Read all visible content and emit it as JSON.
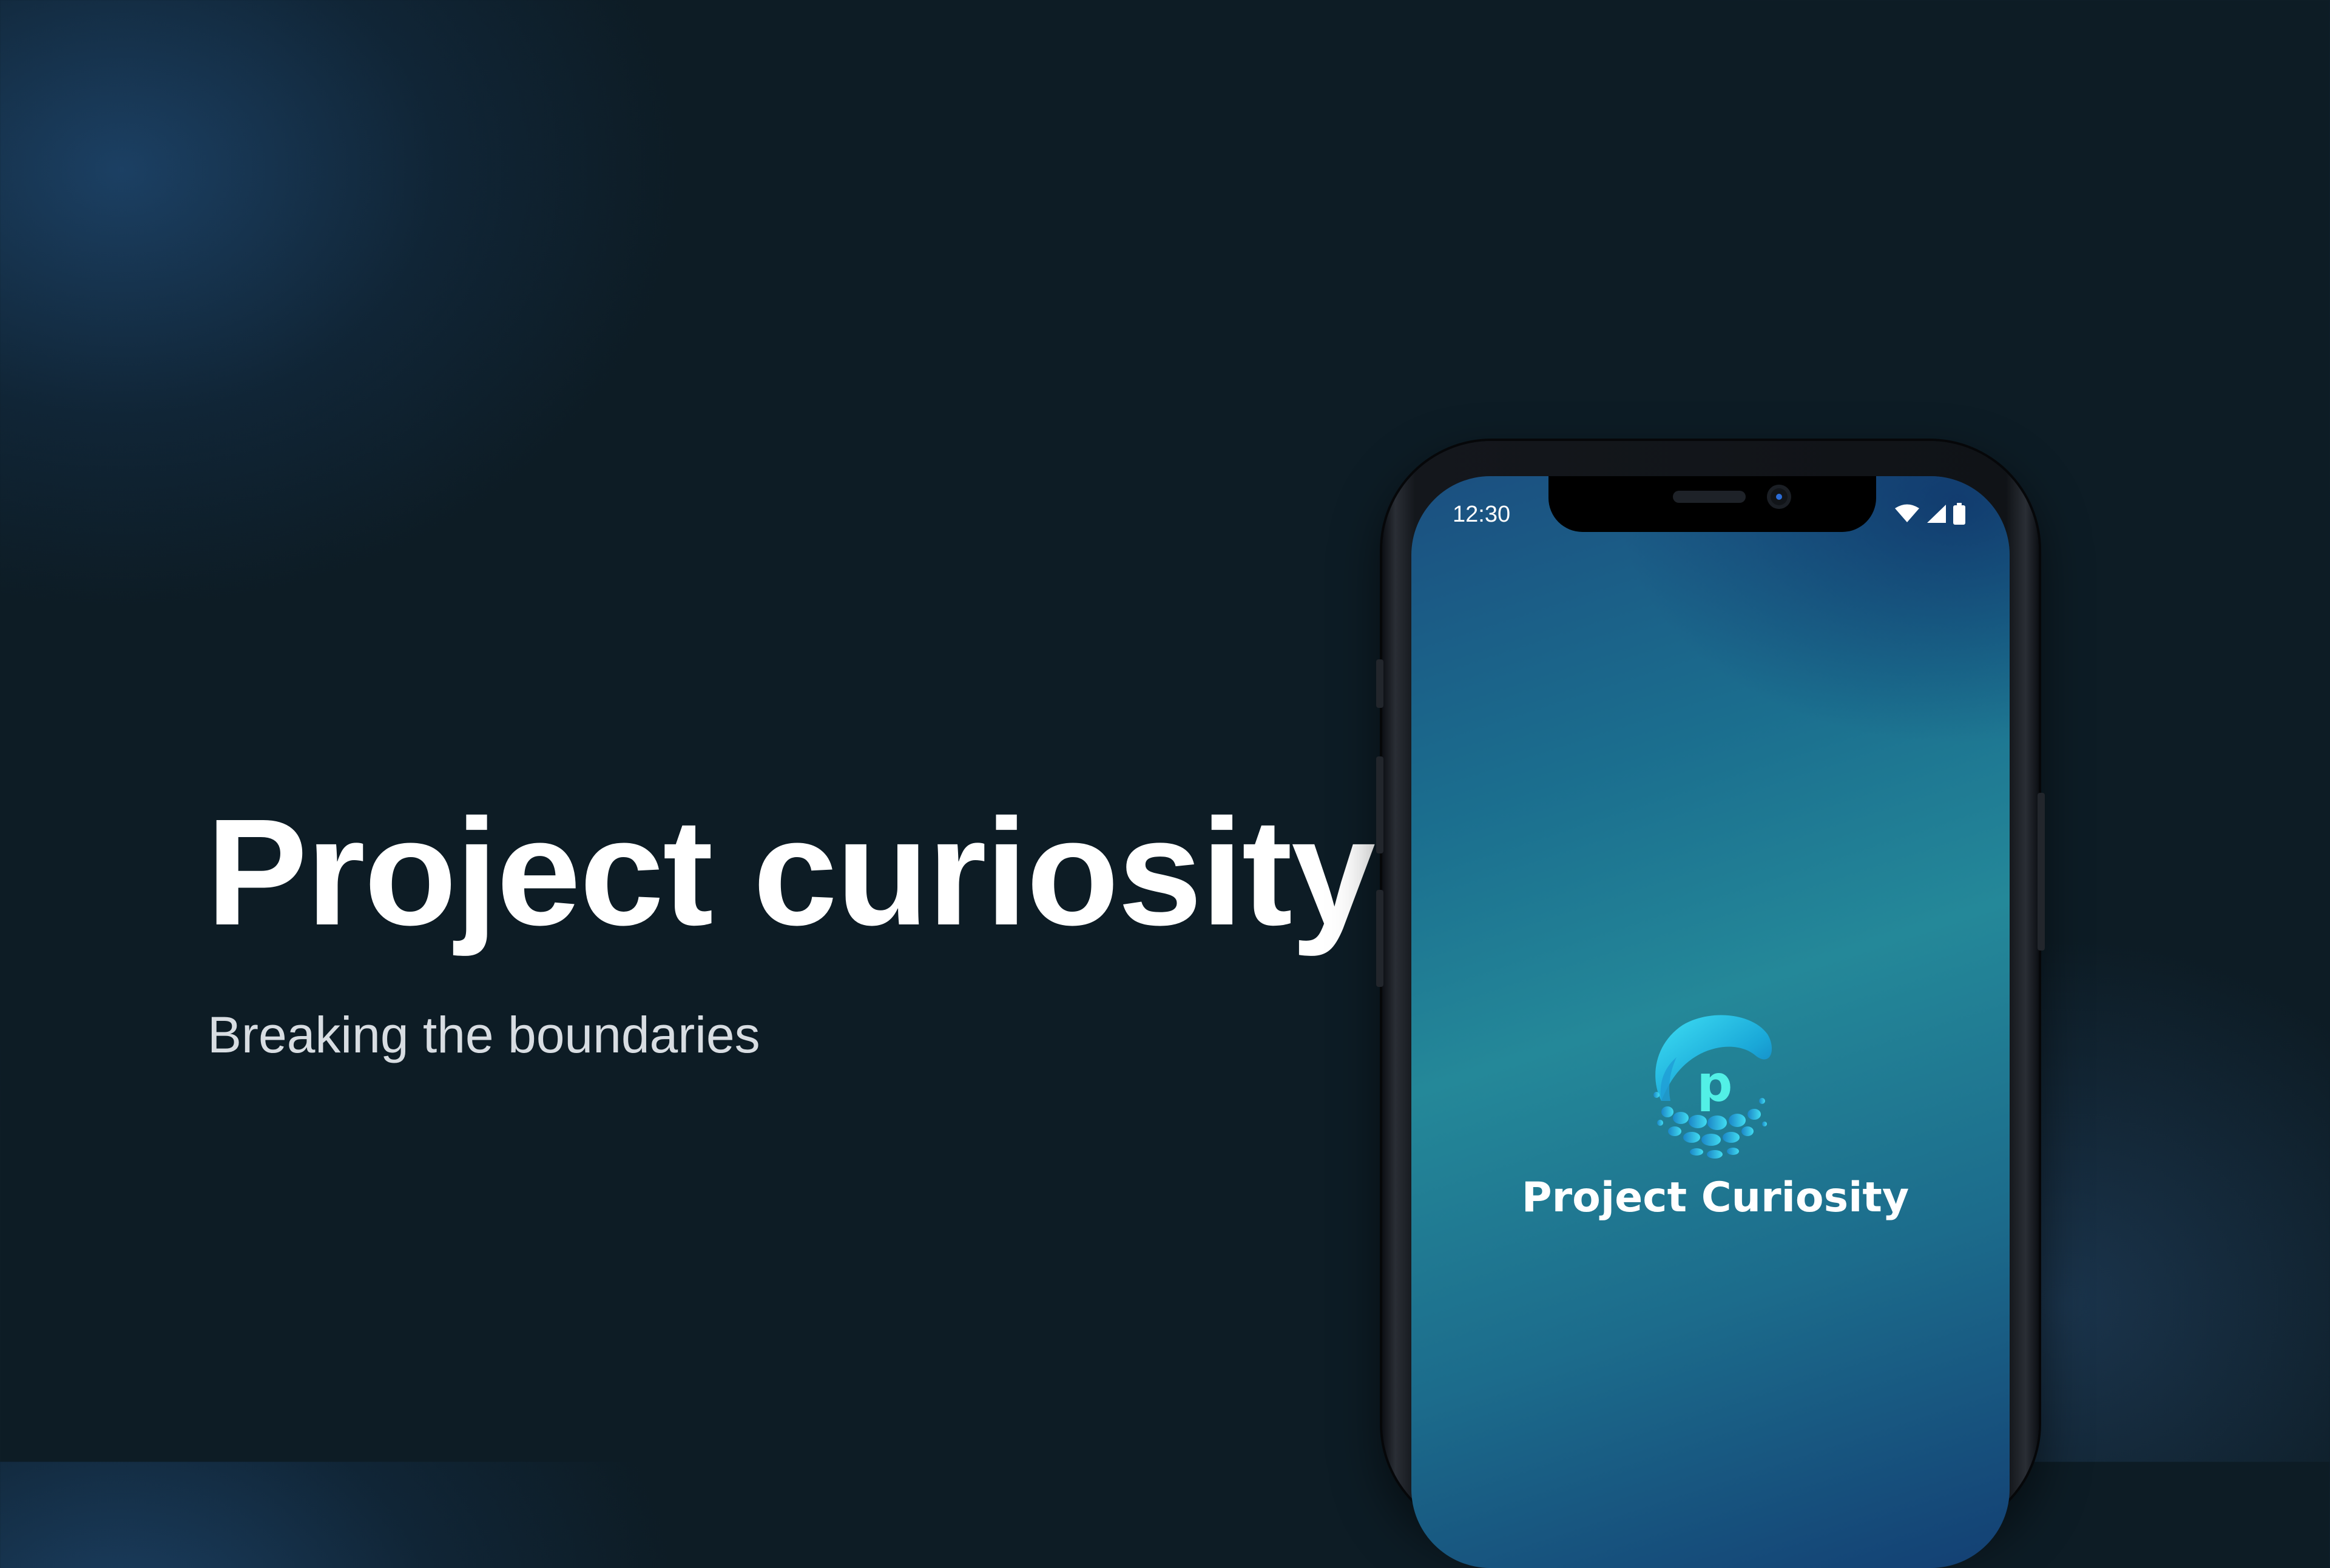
{
  "hero": {
    "title": "Project curiosity",
    "subtitle": "Breaking the boundaries"
  },
  "phone": {
    "status_bar": {
      "time": "12:30",
      "icons": [
        "wifi-icon",
        "cellular-signal-icon",
        "battery-icon"
      ]
    },
    "app": {
      "logo_letter": "p",
      "name": "Project Curiosity"
    }
  },
  "colors": {
    "background": "#0d1c25",
    "screen_gradient_top": "#1b4f80",
    "screen_gradient_middle": "#248899",
    "logo_accent": "#29c8e8",
    "text_primary": "#ffffff"
  }
}
